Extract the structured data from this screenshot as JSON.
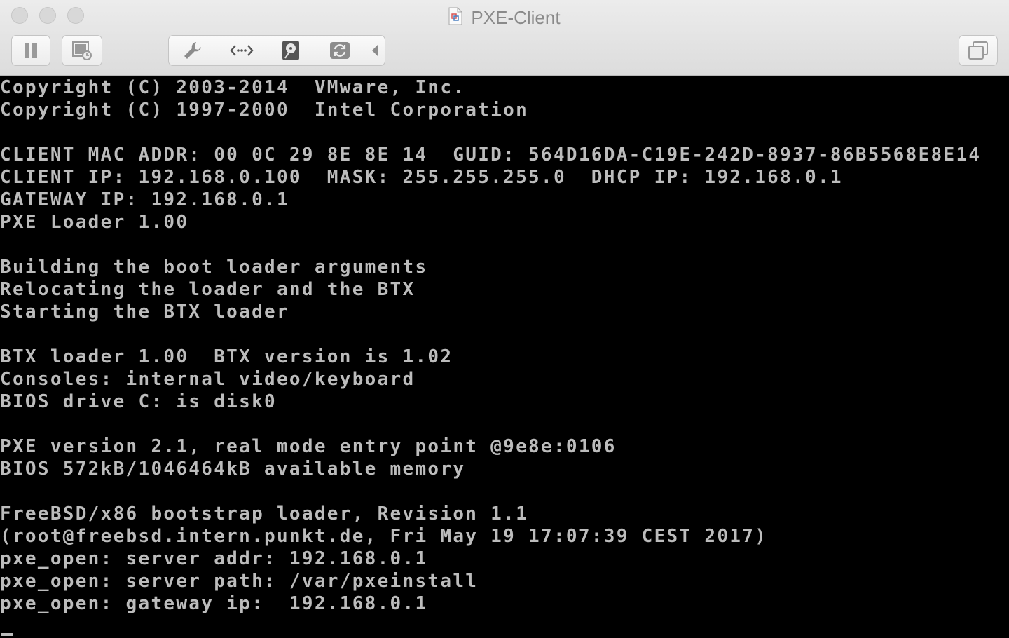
{
  "window": {
    "title": "PXE-Client"
  },
  "toolbar": {
    "pause_icon": "pause-icon",
    "snapshot_icon": "snapshot-icon",
    "settings_icon": "wrench-icon",
    "network_icon": "network-icon",
    "disk_icon": "disk-icon",
    "sync_icon": "sync-icon",
    "collapse_icon": "chevron-left-icon",
    "window_icon": "window-mode-icon"
  },
  "console": {
    "lines": [
      "Copyright (C) 2003-2014  VMware, Inc.",
      "Copyright (C) 1997-2000  Intel Corporation",
      "",
      "CLIENT MAC ADDR: 00 0C 29 8E 8E 14  GUID: 564D16DA-C19E-242D-8937-86B5568E8E14",
      "CLIENT IP: 192.168.0.100  MASK: 255.255.255.0  DHCP IP: 192.168.0.1",
      "GATEWAY IP: 192.168.0.1",
      "PXE Loader 1.00",
      "",
      "Building the boot loader arguments",
      "Relocating the loader and the BTX",
      "Starting the BTX loader",
      "",
      "BTX loader 1.00  BTX version is 1.02",
      "Consoles: internal video/keyboard",
      "BIOS drive C: is disk0",
      "",
      "PXE version 2.1, real mode entry point @9e8e:0106",
      "BIOS 572kB/1046464kB available memory",
      "",
      "FreeBSD/x86 bootstrap loader, Revision 1.1",
      "(root@freebsd.intern.punkt.de, Fri May 19 17:07:39 CEST 2017)",
      "pxe_open: server addr: 192.168.0.1",
      "pxe_open: server path: /var/pxeinstall",
      "pxe_open: gateway ip:  192.168.0.1"
    ]
  },
  "colors": {
    "console_bg": "#000000",
    "console_fg": "#bcbcbc",
    "chrome_bg": "#e3e3e3"
  }
}
